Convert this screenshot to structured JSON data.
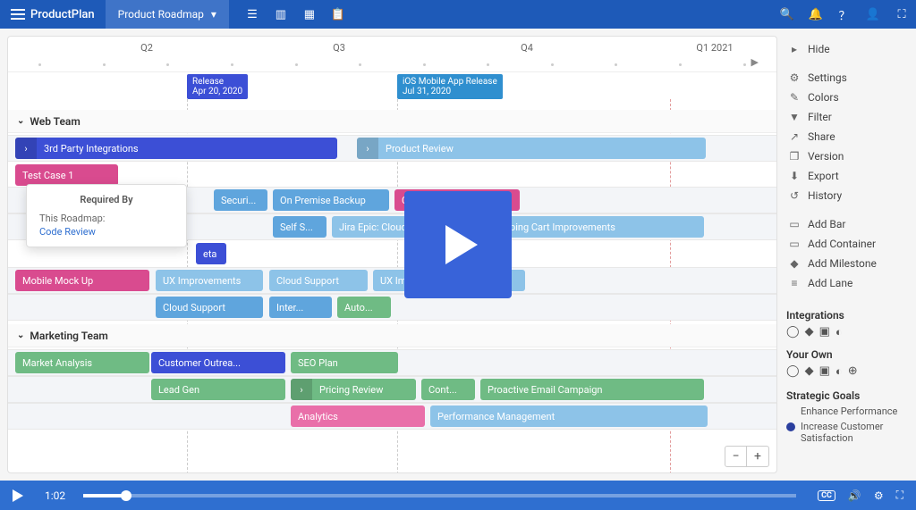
{
  "brand": "ProductPlan",
  "dropdown": "Product Roadmap",
  "timeline": {
    "q2": "Q2",
    "q3": "Q3",
    "q4": "Q4",
    "q1n": "Q1 2021"
  },
  "milestones": {
    "release": {
      "title": "Release",
      "date": "Apr 20, 2020"
    },
    "ios": {
      "title": "iOS Mobile App Release",
      "date": "Jul 31, 2020"
    }
  },
  "lanes": {
    "web": "Web Team",
    "marketing": "Marketing Team"
  },
  "bars": {
    "thirdparty": "3rd Party Integrations",
    "productreview": "Product Review",
    "testcase": "Test Case 1",
    "security": "Securi...",
    "onpremise": "On Premise Backup",
    "codereview": "Code Review",
    "selfs": "Self S...",
    "jiraepic": "Jira Epic: Cloud S...",
    "shopping": "Shopping Cart Improvements",
    "beta": "eta",
    "mobilemock": "Mobile Mock Up",
    "ux1": "UX Improvements",
    "cloud1": "Cloud Support",
    "ux2": "UX Improvements",
    "cloud2": "Cloud Support",
    "inter": "Inter...",
    "auto": "Auto...",
    "market": "Market Analysis",
    "outreach": "Customer Outrea...",
    "seo": "SEO Plan",
    "leadgen": "Lead Gen",
    "pricing": "Pricing Review",
    "cont": "Cont...",
    "proactive": "Proactive Email Campaign",
    "analytics": "Analytics",
    "perf": "Performance Management"
  },
  "popover": {
    "title": "Required By",
    "label": "This Roadmap:",
    "link": "Code Review"
  },
  "sidebar": {
    "hide": "Hide",
    "settings": "Settings",
    "colors": "Colors",
    "filter": "Filter",
    "share": "Share",
    "version": "Version",
    "export": "Export",
    "history": "History",
    "addbar": "Add Bar",
    "addcontainer": "Add Container",
    "addmilestone": "Add Milestone",
    "addlane": "Add Lane",
    "integrations": "Integrations",
    "yourown": "Your Own",
    "goals": "Strategic Goals",
    "goal1": "Enhance Performance",
    "goal2": "Increase Customer Satisfaction"
  },
  "goalColors": {
    "g1": "#5fa5dd",
    "g2": "#2b3f9e"
  },
  "video": {
    "time": "1:02",
    "progressPct": 6
  }
}
